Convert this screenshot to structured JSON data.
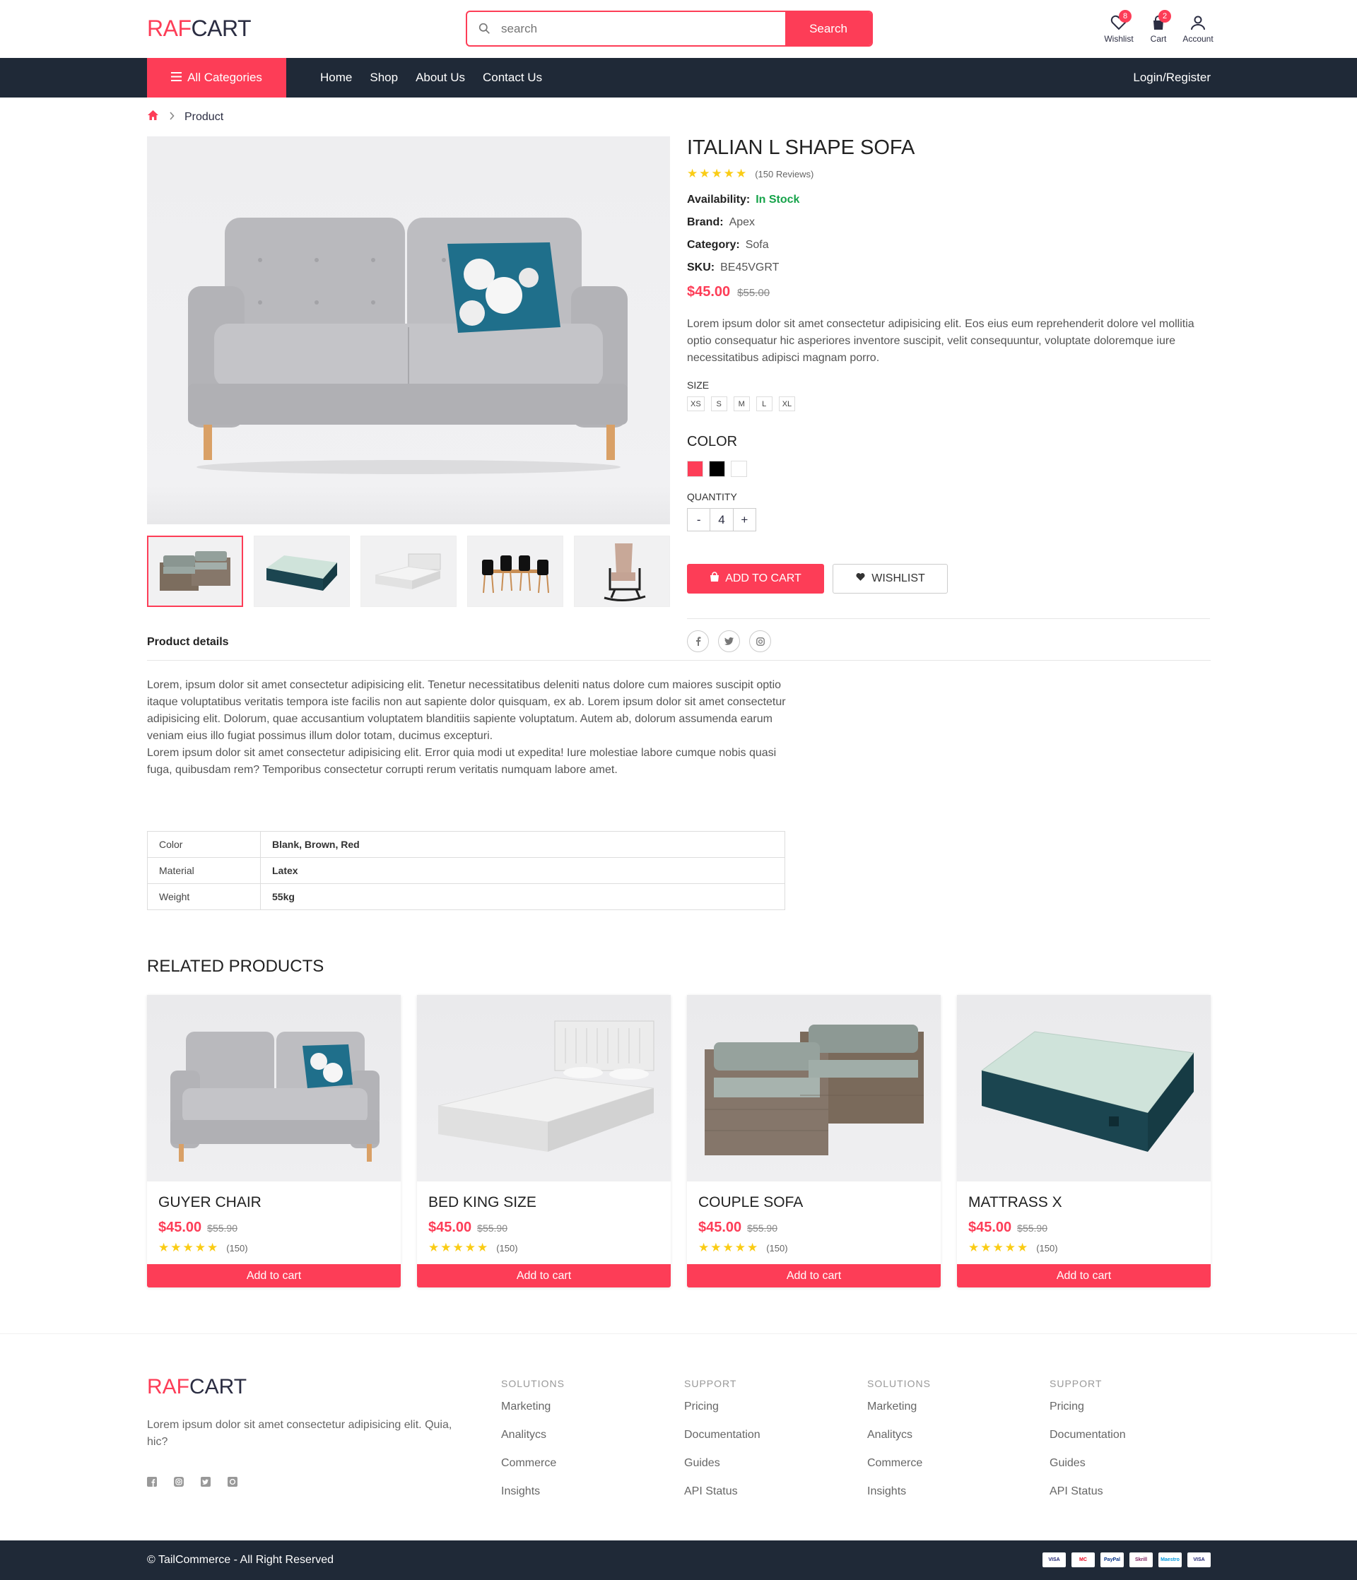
{
  "header": {
    "logo_a": "RAF",
    "logo_b": "CART",
    "search_placeholder": "search",
    "search_button": "Search",
    "wishlist_label": "Wishlist",
    "wishlist_count": "8",
    "cart_label": "Cart",
    "cart_count": "2",
    "account_label": "Account"
  },
  "nav": {
    "all_categories": "All Categories",
    "links": [
      "Home",
      "Shop",
      "About Us",
      "Contact Us"
    ],
    "login": "Login/Register"
  },
  "breadcrumb": {
    "current": "Product"
  },
  "product": {
    "title": "ITALIAN L SHAPE SOFA",
    "stars": "★★★★★",
    "reviews": "(150 Reviews)",
    "availability_label": "Availability:",
    "availability_value": "In Stock",
    "brand_label": "Brand:",
    "brand_value": "Apex",
    "category_label": "Category:",
    "category_value": "Sofa",
    "sku_label": "SKU:",
    "sku_value": "BE45VGRT",
    "price": "$45.00",
    "old_price": "$55.00",
    "description": "Lorem ipsum dolor sit amet consectetur adipisicing elit. Eos eius eum reprehenderit dolore vel mollitia optio consequatur hic asperiores inventore suscipit, velit consequuntur, voluptate doloremque iure necessitatibus adipisci magnam porro.",
    "size_label": "SIZE",
    "sizes": [
      "XS",
      "S",
      "M",
      "L",
      "XL"
    ],
    "color_label": "COLOR",
    "colors": [
      "#fd3d57",
      "#000000",
      "#ffffff"
    ],
    "quantity_label": "QUANTITY",
    "qty_minus": "-",
    "quantity": "4",
    "qty_plus": "+",
    "add_to_cart": "ADD TO CART",
    "wishlist": "WISHLIST"
  },
  "details": {
    "title": "Product details",
    "p1": "Lorem, ipsum dolor sit amet consectetur adipisicing elit. Tenetur necessitatibus deleniti natus dolore cum maiores suscipit optio itaque voluptatibus veritatis tempora iste facilis non aut sapiente dolor quisquam, ex ab. Lorem ipsum dolor sit amet consectetur adipisicing elit. Dolorum, quae accusantium voluptatem blanditiis sapiente voluptatum. Autem ab, dolorum assumenda earum veniam eius illo fugiat possimus illum dolor totam, ducimus excepturi.",
    "p2": "Lorem ipsum dolor sit amet consectetur adipisicing elit. Error quia modi ut expedita! Iure molestiae labore cumque nobis quasi fuga, quibusdam rem? Temporibus consectetur corrupti rerum veritatis numquam labore amet.",
    "specs": [
      {
        "k": "Color",
        "v": "Blank, Brown, Red"
      },
      {
        "k": "Material",
        "v": "Latex"
      },
      {
        "k": "Weight",
        "v": "55kg"
      }
    ]
  },
  "related": {
    "title": "RELATED PRODUCTS",
    "items": [
      {
        "name": "GUYER CHAIR",
        "price": "$45.00",
        "old": "$55.90",
        "stars": "★★★★★",
        "count": "(150)",
        "button": "Add to cart"
      },
      {
        "name": "BED KING SIZE",
        "price": "$45.00",
        "old": "$55.90",
        "stars": "★★★★★",
        "count": "(150)",
        "button": "Add to cart"
      },
      {
        "name": "COUPLE SOFA",
        "price": "$45.00",
        "old": "$55.90",
        "stars": "★★★★★",
        "count": "(150)",
        "button": "Add to cart"
      },
      {
        "name": "MATTRASS X",
        "price": "$45.00",
        "old": "$55.90",
        "stars": "★★★★★",
        "count": "(150)",
        "button": "Add to cart"
      }
    ]
  },
  "footer": {
    "logo_a": "RAF",
    "logo_b": "CART",
    "text": "Lorem ipsum dolor sit amet consectetur adipisicing elit. Quia, hic?",
    "columns": [
      {
        "heading": "SOLUTIONS",
        "links": [
          "Marketing",
          "Analitycs",
          "Commerce",
          "Insights"
        ]
      },
      {
        "heading": "SUPPORT",
        "links": [
          "Pricing",
          "Documentation",
          "Guides",
          "API Status"
        ]
      },
      {
        "heading": "SOLUTIONS",
        "links": [
          "Marketing",
          "Analitycs",
          "Commerce",
          "Insights"
        ]
      },
      {
        "heading": "SUPPORT",
        "links": [
          "Pricing",
          "Documentation",
          "Guides",
          "API Status"
        ]
      }
    ],
    "copyright": "© TailCommerce - All Right Reserved",
    "payments": [
      "VISA",
      "MC",
      "PayPal",
      "Skrill",
      "Maestro",
      "VISA"
    ]
  },
  "accent_color": "#fd3d57",
  "dark_color": "#1f2937"
}
